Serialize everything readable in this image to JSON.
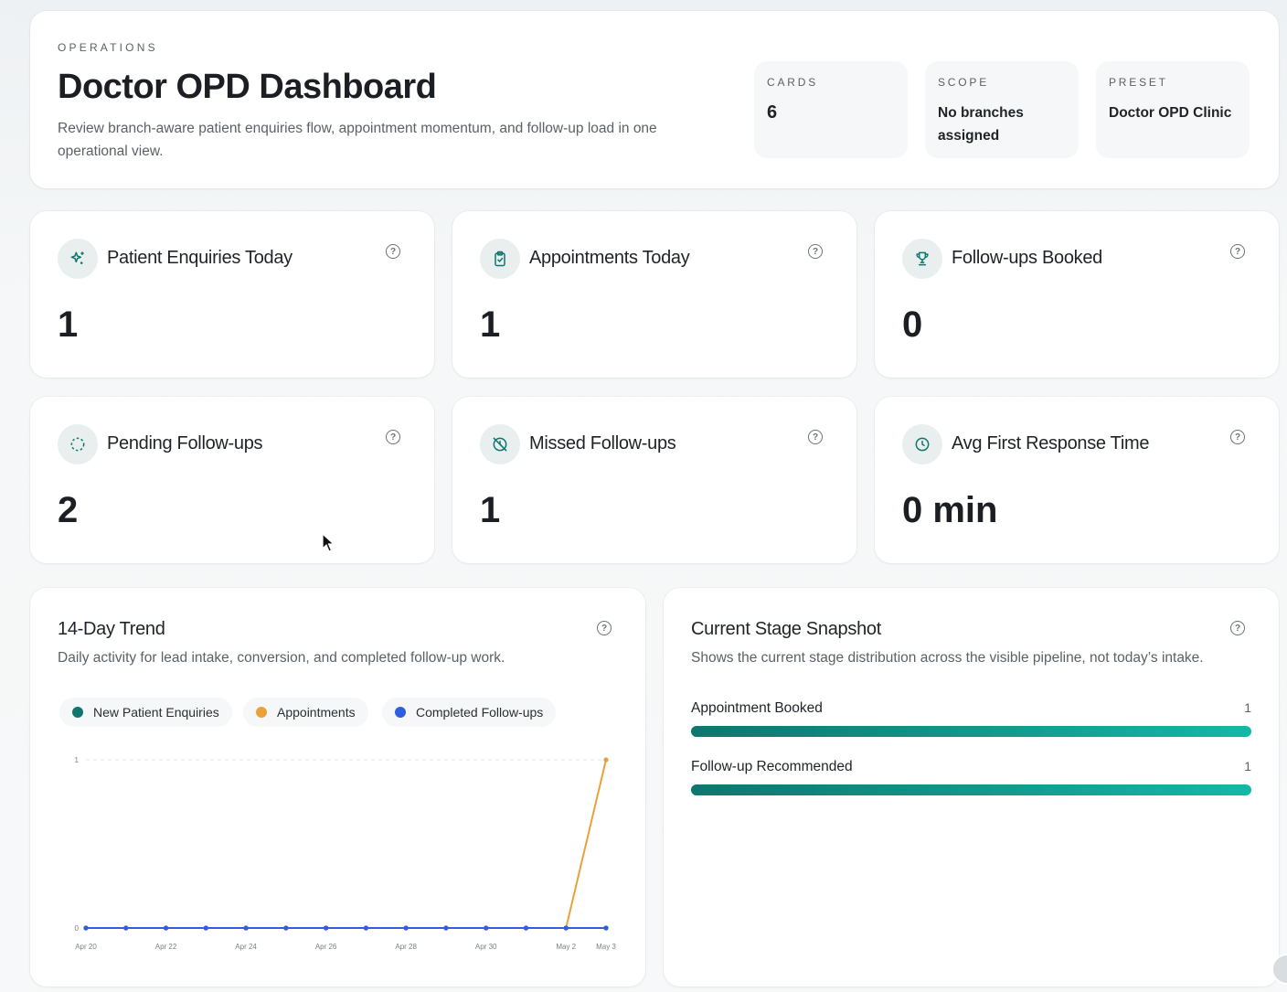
{
  "header": {
    "eyebrow": "OPERATIONS",
    "title": "Doctor OPD Dashboard",
    "subtitle": "Review branch-aware patient enquiries flow, appointment momentum, and follow-up load in one operational view.",
    "meta": [
      {
        "label": "CARDS",
        "value": "6"
      },
      {
        "label": "SCOPE",
        "value": "No branches assigned"
      },
      {
        "label": "PRESET",
        "value": "Doctor OPD Clinic"
      }
    ]
  },
  "kpis": [
    {
      "title": "Patient Enquiries Today",
      "value": "1",
      "icon": "sparkle-icon"
    },
    {
      "title": "Appointments Today",
      "value": "1",
      "icon": "clipboard-check-icon"
    },
    {
      "title": "Follow-ups Booked",
      "value": "0",
      "icon": "trophy-icon"
    },
    {
      "title": "Pending Follow-ups",
      "value": "2",
      "icon": "dashed-circle-icon"
    },
    {
      "title": "Missed Follow-ups",
      "value": "1",
      "icon": "clock-off-icon"
    },
    {
      "title": "Avg First Response Time",
      "value": "0 min",
      "icon": "clock-icon"
    }
  ],
  "help_glyph": "?",
  "trend": {
    "title": "14-Day Trend",
    "description": "Daily activity for lead intake, conversion, and completed follow-up work."
  },
  "stage": {
    "title": "Current Stage Snapshot",
    "description": "Shows the current stage distribution across the visible pipeline, not today’s intake.",
    "rows": [
      {
        "label": "Appointment Booked",
        "count": "1",
        "fraction": 1.0
      },
      {
        "label": "Follow-up Recommended",
        "count": "1",
        "fraction": 1.0
      }
    ]
  },
  "colors": {
    "enquiries": "#0f766e",
    "appointments": "#e9a23b",
    "followups": "#2f5fdc"
  },
  "chart_data": {
    "type": "line",
    "x": [
      "Apr 20",
      "Apr 21",
      "Apr 22",
      "Apr 23",
      "Apr 24",
      "Apr 25",
      "Apr 26",
      "Apr 27",
      "Apr 28",
      "Apr 29",
      "Apr 30",
      "May 1",
      "May 2",
      "May 3"
    ],
    "x_tick_labels": [
      "Apr 20",
      "Apr 22",
      "Apr 24",
      "Apr 26",
      "Apr 28",
      "Apr 30",
      "May 2",
      "May 3"
    ],
    "ylim": [
      0,
      1
    ],
    "y_ticks": [
      "0",
      "1"
    ],
    "legend_position": "top-left",
    "series": [
      {
        "name": "New Patient Enquiries",
        "color": "#0f766e",
        "values": [
          0,
          0,
          0,
          0,
          0,
          0,
          0,
          0,
          0,
          0,
          0,
          0,
          0,
          0
        ]
      },
      {
        "name": "Appointments",
        "color": "#e9a23b",
        "values": [
          0,
          0,
          0,
          0,
          0,
          0,
          0,
          0,
          0,
          0,
          0,
          0,
          0,
          1
        ]
      },
      {
        "name": "Completed Follow-ups",
        "color": "#2f5fdc",
        "values": [
          0,
          0,
          0,
          0,
          0,
          0,
          0,
          0,
          0,
          0,
          0,
          0,
          0,
          0
        ]
      }
    ]
  }
}
